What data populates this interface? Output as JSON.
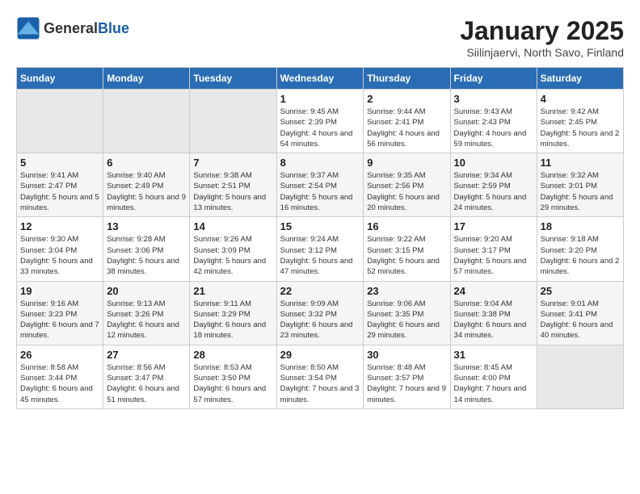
{
  "header": {
    "logo_general": "General",
    "logo_blue": "Blue",
    "title": "January 2025",
    "subtitle": "Siilinjaervi, North Savo, Finland"
  },
  "days_of_week": [
    "Sunday",
    "Monday",
    "Tuesday",
    "Wednesday",
    "Thursday",
    "Friday",
    "Saturday"
  ],
  "weeks": [
    [
      {
        "day": "",
        "info": ""
      },
      {
        "day": "",
        "info": ""
      },
      {
        "day": "",
        "info": ""
      },
      {
        "day": "1",
        "info": "Sunrise: 9:45 AM\nSunset: 2:39 PM\nDaylight: 4 hours and 54 minutes."
      },
      {
        "day": "2",
        "info": "Sunrise: 9:44 AM\nSunset: 2:41 PM\nDaylight: 4 hours and 56 minutes."
      },
      {
        "day": "3",
        "info": "Sunrise: 9:43 AM\nSunset: 2:43 PM\nDaylight: 4 hours and 59 minutes."
      },
      {
        "day": "4",
        "info": "Sunrise: 9:42 AM\nSunset: 2:45 PM\nDaylight: 5 hours and 2 minutes."
      }
    ],
    [
      {
        "day": "5",
        "info": "Sunrise: 9:41 AM\nSunset: 2:47 PM\nDaylight: 5 hours and 5 minutes."
      },
      {
        "day": "6",
        "info": "Sunrise: 9:40 AM\nSunset: 2:49 PM\nDaylight: 5 hours and 9 minutes."
      },
      {
        "day": "7",
        "info": "Sunrise: 9:38 AM\nSunset: 2:51 PM\nDaylight: 5 hours and 13 minutes."
      },
      {
        "day": "8",
        "info": "Sunrise: 9:37 AM\nSunset: 2:54 PM\nDaylight: 5 hours and 16 minutes."
      },
      {
        "day": "9",
        "info": "Sunrise: 9:35 AM\nSunset: 2:56 PM\nDaylight: 5 hours and 20 minutes."
      },
      {
        "day": "10",
        "info": "Sunrise: 9:34 AM\nSunset: 2:59 PM\nDaylight: 5 hours and 24 minutes."
      },
      {
        "day": "11",
        "info": "Sunrise: 9:32 AM\nSunset: 3:01 PM\nDaylight: 5 hours and 29 minutes."
      }
    ],
    [
      {
        "day": "12",
        "info": "Sunrise: 9:30 AM\nSunset: 3:04 PM\nDaylight: 5 hours and 33 minutes."
      },
      {
        "day": "13",
        "info": "Sunrise: 9:28 AM\nSunset: 3:06 PM\nDaylight: 5 hours and 38 minutes."
      },
      {
        "day": "14",
        "info": "Sunrise: 9:26 AM\nSunset: 3:09 PM\nDaylight: 5 hours and 42 minutes."
      },
      {
        "day": "15",
        "info": "Sunrise: 9:24 AM\nSunset: 3:12 PM\nDaylight: 5 hours and 47 minutes."
      },
      {
        "day": "16",
        "info": "Sunrise: 9:22 AM\nSunset: 3:15 PM\nDaylight: 5 hours and 52 minutes."
      },
      {
        "day": "17",
        "info": "Sunrise: 9:20 AM\nSunset: 3:17 PM\nDaylight: 5 hours and 57 minutes."
      },
      {
        "day": "18",
        "info": "Sunrise: 9:18 AM\nSunset: 3:20 PM\nDaylight: 6 hours and 2 minutes."
      }
    ],
    [
      {
        "day": "19",
        "info": "Sunrise: 9:16 AM\nSunset: 3:23 PM\nDaylight: 6 hours and 7 minutes."
      },
      {
        "day": "20",
        "info": "Sunrise: 9:13 AM\nSunset: 3:26 PM\nDaylight: 6 hours and 12 minutes."
      },
      {
        "day": "21",
        "info": "Sunrise: 9:11 AM\nSunset: 3:29 PM\nDaylight: 6 hours and 18 minutes."
      },
      {
        "day": "22",
        "info": "Sunrise: 9:09 AM\nSunset: 3:32 PM\nDaylight: 6 hours and 23 minutes."
      },
      {
        "day": "23",
        "info": "Sunrise: 9:06 AM\nSunset: 3:35 PM\nDaylight: 6 hours and 29 minutes."
      },
      {
        "day": "24",
        "info": "Sunrise: 9:04 AM\nSunset: 3:38 PM\nDaylight: 6 hours and 34 minutes."
      },
      {
        "day": "25",
        "info": "Sunrise: 9:01 AM\nSunset: 3:41 PM\nDaylight: 6 hours and 40 minutes."
      }
    ],
    [
      {
        "day": "26",
        "info": "Sunrise: 8:58 AM\nSunset: 3:44 PM\nDaylight: 6 hours and 45 minutes."
      },
      {
        "day": "27",
        "info": "Sunrise: 8:56 AM\nSunset: 3:47 PM\nDaylight: 6 hours and 51 minutes."
      },
      {
        "day": "28",
        "info": "Sunrise: 8:53 AM\nSunset: 3:50 PM\nDaylight: 6 hours and 57 minutes."
      },
      {
        "day": "29",
        "info": "Sunrise: 8:50 AM\nSunset: 3:54 PM\nDaylight: 7 hours and 3 minutes."
      },
      {
        "day": "30",
        "info": "Sunrise: 8:48 AM\nSunset: 3:57 PM\nDaylight: 7 hours and 9 minutes."
      },
      {
        "day": "31",
        "info": "Sunrise: 8:45 AM\nSunset: 4:00 PM\nDaylight: 7 hours and 14 minutes."
      },
      {
        "day": "",
        "info": ""
      }
    ]
  ]
}
